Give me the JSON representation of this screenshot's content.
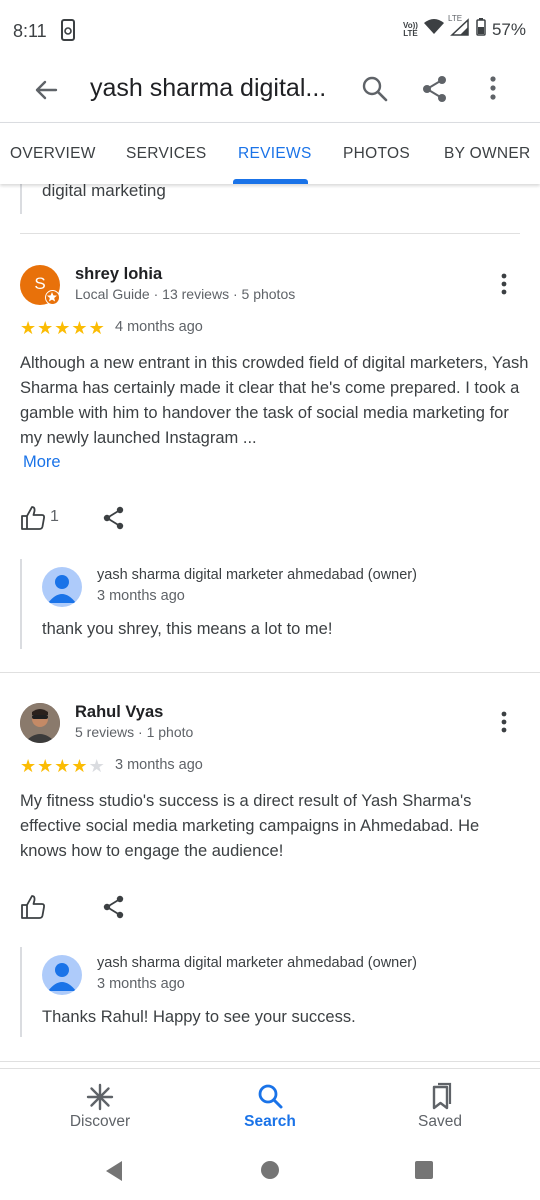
{
  "status_bar": {
    "time": "8:11",
    "network_badge_top": "Vo))",
    "network_badge_bottom": "LTE",
    "lte_label": "LTE",
    "battery": "57%"
  },
  "header": {
    "title": "yash sharma digital..."
  },
  "tabs": [
    {
      "label": "OVERVIEW",
      "active": false
    },
    {
      "label": "SERVICES",
      "active": false
    },
    {
      "label": "REVIEWS",
      "active": true
    },
    {
      "label": "PHOTOS",
      "active": false
    },
    {
      "label": "BY OWNER",
      "active": false
    }
  ],
  "previous_snippet": "digital marketing",
  "reviews": [
    {
      "avatar_letter": "S",
      "avatar_color": "#e8710a",
      "author": "shrey lohia",
      "meta": "Local Guide · 13 reviews · 5 photos",
      "rating": 5,
      "date": "4 months ago",
      "body": "Although a new entrant in this crowded field of digital marketers, Yash Sharma has certainly made it clear that he's come prepared. I took a gamble with him to handover the task of social media marketing for my newly launched Instagram ...",
      "more_label": "More",
      "likes": "1",
      "reply": {
        "name": "yash sharma digital marketer ahmedabad (owner)",
        "date": "3 months ago",
        "text": "thank you shrey, this means a lot to me!"
      }
    },
    {
      "author": "Rahul Vyas",
      "meta": "5 reviews · 1 photo",
      "rating": 4,
      "date": "3 months ago",
      "body": "My fitness studio's success is a direct result of Yash Sharma's effective social media marketing campaigns in Ahmedabad. He knows how to engage the audience!",
      "reply": {
        "name": "yash sharma digital marketer ahmedabad (owner)",
        "date": "3 months ago",
        "text": "Thanks Rahul! Happy to see your success."
      }
    }
  ],
  "bottom_nav": [
    {
      "label": "Discover",
      "icon": "asterisk-icon",
      "active": false
    },
    {
      "label": "Search",
      "icon": "search-icon",
      "active": true
    },
    {
      "label": "Saved",
      "icon": "bookmarks-icon",
      "active": false
    }
  ],
  "colors": {
    "accent": "#1a73e8",
    "star": "#fbbc04",
    "text_primary": "#202124",
    "text_secondary": "#5f6368"
  }
}
